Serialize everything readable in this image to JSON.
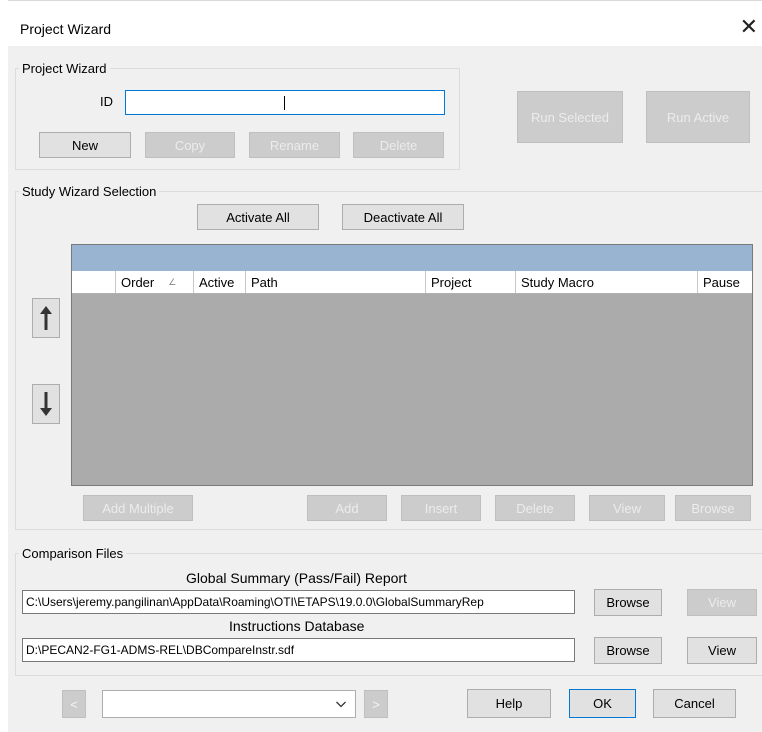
{
  "window": {
    "title": "Project Wizard",
    "close": "✕"
  },
  "project_wizard": {
    "group_label": "Project Wizard",
    "id_label": "ID",
    "id_value": "",
    "buttons": {
      "new": "New",
      "copy": "Copy",
      "rename": "Rename",
      "delete": "Delete"
    },
    "run_selected": "Run Selected",
    "run_active": "Run Active"
  },
  "study_wizard": {
    "group_label": "Study Wizard Selection",
    "activate_all": "Activate All",
    "deactivate_all": "Deactivate All",
    "columns": [
      "",
      "Order",
      "Active",
      "Path",
      "Project",
      "Study Macro",
      "Pause"
    ],
    "sort_indicator": "∠",
    "move_up_icon": "arrow-up-icon",
    "move_down_icon": "arrow-down-icon",
    "buttons": {
      "add_multiple": "Add Multiple",
      "add": "Add",
      "insert": "Insert",
      "delete": "Delete",
      "view": "View",
      "browse": "Browse"
    }
  },
  "comparison": {
    "group_label": "Comparison Files",
    "report_label": "Global Summary (Pass/Fail) Report",
    "report_path": "C:\\Users\\jeremy.pangilinan\\AppData\\Roaming\\OTI\\ETAPS\\19.0.0\\GlobalSummaryRep",
    "report_browse": "Browse",
    "report_view": "View",
    "db_label": "Instructions Database",
    "db_path": "D:\\PECAN2-FG1-ADMS-REL\\DBCompareInstr.sdf",
    "db_browse": "Browse",
    "db_view": "View"
  },
  "footer": {
    "prev": "<",
    "next": ">",
    "combo_value": "",
    "help": "Help",
    "ok": "OK",
    "cancel": "Cancel"
  },
  "colors": {
    "dialog_bg": "#f0f0f0",
    "grid_bg": "#ababab",
    "grid_header_band": "#99b4d1",
    "focus_border": "#0078d7"
  }
}
